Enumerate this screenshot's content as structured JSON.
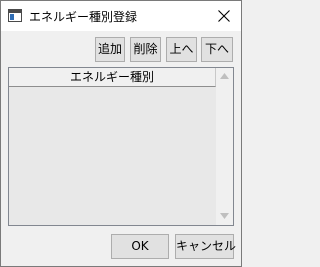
{
  "window": {
    "title": "エネルギー種別登録"
  },
  "toolbar": {
    "add_label": "追加",
    "delete_label": "削除",
    "up_label": "上へ",
    "down_label": "下へ"
  },
  "list": {
    "columns": [
      "エネルギー種別"
    ],
    "rows": []
  },
  "footer": {
    "ok_label": "OK",
    "cancel_label": "キャンセル"
  },
  "icons": {
    "app": "window-app-icon",
    "close": "close-icon",
    "scroll_up": "scroll-up-arrow-icon",
    "scroll_down": "scroll-down-arrow-icon"
  }
}
